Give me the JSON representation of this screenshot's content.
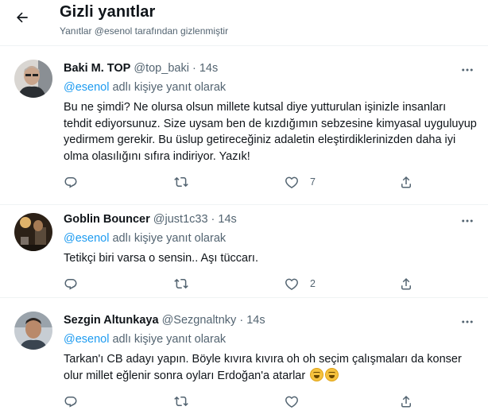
{
  "header": {
    "title": "Gizli yanıtlar",
    "subtitle": "Yanıtlar @esenol tarafından gizlenmiştir"
  },
  "colors": {
    "accent": "#1d9bf0",
    "muted": "#536471",
    "text": "#0f1419",
    "divider": "#eff3f4"
  },
  "tweets": [
    {
      "name": "Baki M. TOP",
      "handle": "@top_baki",
      "dot": "·",
      "time": "14s",
      "mention": "@esenol",
      "reply_suffix": " adlı kişiye yanıt olarak",
      "text": "Bu ne şimdi? Ne olursa olsun millete kutsal diye yutturulan işinizle insanları tehdit ediyorsunuz. Size uysam ben de kızdığımın sebzesine kimyasal uyguluyup yedirmem gerekir. Bu üslup getireceğiniz adaletin eleştirdiklerinizden daha iyi olma olasılığını sıfıra indiriyor. Yazık!",
      "likes": "7"
    },
    {
      "name": "Goblin Bouncer",
      "handle": "@just1c33",
      "dot": "·",
      "time": "14s",
      "mention": "@esenol",
      "reply_suffix": " adlı kişiye yanıt olarak",
      "text": "Tetikçi biri varsa o sensin.. Aşı tüccarı.",
      "likes": "2"
    },
    {
      "name": "Sezgin Altunkaya",
      "handle": "@Sezgnaltnky",
      "dot": "·",
      "time": "14s",
      "mention": "@esenol",
      "reply_suffix": " adlı kişiye yanıt olarak",
      "text": "Tarkan'ı CB adayı yapın. Böyle kıvıra kıvıra oh oh seçim çalışmaları da konser olur millet eğlenir sonra oyları Erdoğan'a atarlar",
      "likes": ""
    }
  ],
  "icons": [
    "back-arrow-icon",
    "more-icon",
    "reply-icon",
    "retweet-icon",
    "like-icon",
    "share-icon",
    "grinning-emoji-icon"
  ]
}
